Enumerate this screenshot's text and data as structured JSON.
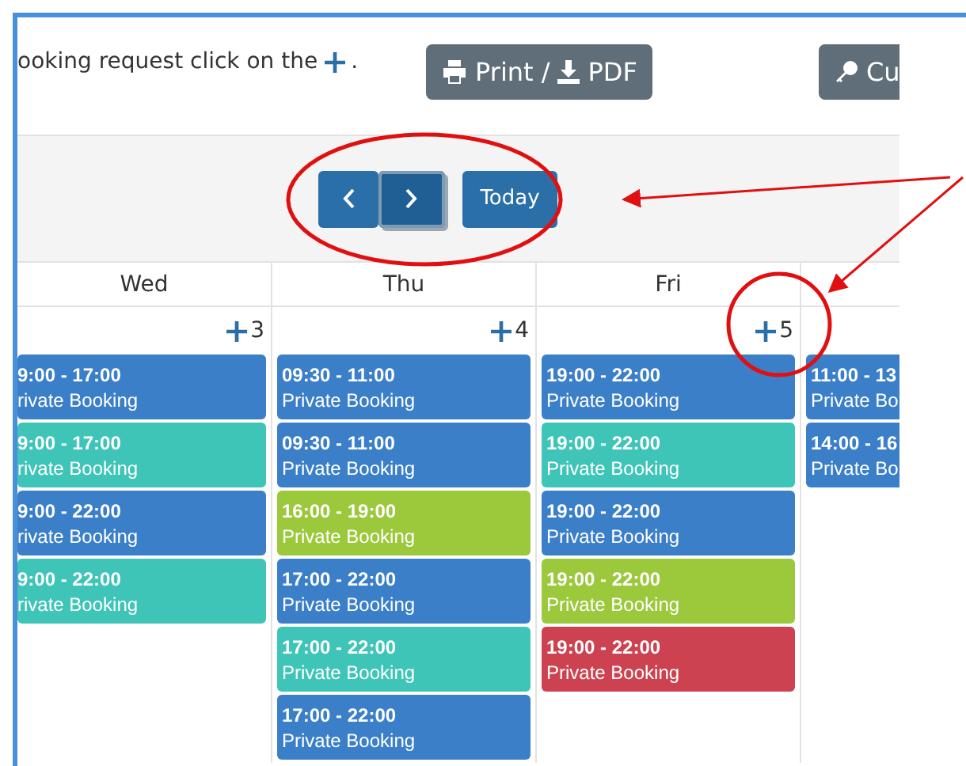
{
  "intro": {
    "text": "ooking request click on the",
    "end": "."
  },
  "toolbar_buttons": [
    {
      "kind": "print",
      "label": "Print /",
      "label_2": "PDF"
    },
    {
      "kind": "key",
      "label": "Cu"
    }
  ],
  "nav": [
    {
      "kind": "prev",
      "focused": false
    },
    {
      "kind": "next",
      "focused": true
    },
    {
      "kind": "today",
      "label": "Today",
      "focused": false
    }
  ],
  "days": [
    {
      "name": "Wed",
      "add_count": "3",
      "events": [
        {
          "time": "9:00 - 17:00",
          "title": "rivate Booking",
          "color": "#3b7fc8"
        },
        {
          "time": "9:00 - 17:00",
          "title": "rivate Booking",
          "color": "#3fc4b8"
        },
        {
          "time": "9:00 - 22:00",
          "title": "rivate Booking",
          "color": "#3b7fc8"
        },
        {
          "time": "9:00 - 22:00",
          "title": "rivate Booking",
          "color": "#3fc4b8"
        }
      ]
    },
    {
      "name": "Thu",
      "add_count": "4",
      "events": [
        {
          "time": "09:30 - 11:00",
          "title": "Private Booking",
          "color": "#3b7fc8"
        },
        {
          "time": "09:30 - 11:00",
          "title": "Private Booking",
          "color": "#3b7fc8"
        },
        {
          "time": "16:00 - 19:00",
          "title": "Private Booking",
          "color": "#9cc83c"
        },
        {
          "time": "17:00 - 22:00",
          "title": "Private Booking",
          "color": "#3b7fc8"
        },
        {
          "time": "17:00 - 22:00",
          "title": "Private Booking",
          "color": "#3fc4b8"
        },
        {
          "time": "17:00 - 22:00",
          "title": "Private Booking",
          "color": "#3b7fc8"
        }
      ]
    },
    {
      "name": "Fri",
      "add_count": "5",
      "events": [
        {
          "time": "19:00 - 22:00",
          "title": "Private Booking",
          "color": "#3b7fc8"
        },
        {
          "time": "19:00 - 22:00",
          "title": "Private Booking",
          "color": "#3fc4b8"
        },
        {
          "time": "19:00 - 22:00",
          "title": "Private Booking",
          "color": "#3b7fc8"
        },
        {
          "time": "19:00 - 22:00",
          "title": "Private Booking",
          "color": "#9cc83c"
        },
        {
          "time": "19:00 - 22:00",
          "title": "Private Booking",
          "color": "#cc4250"
        }
      ]
    },
    {
      "events": [
        {
          "time": "11:00 - 13",
          "title": "Private Bo",
          "color": "#3b7fc8"
        },
        {
          "time": "14:00 - 16",
          "title": "Private Bo",
          "color": "#3b7fc8"
        }
      ]
    }
  ]
}
